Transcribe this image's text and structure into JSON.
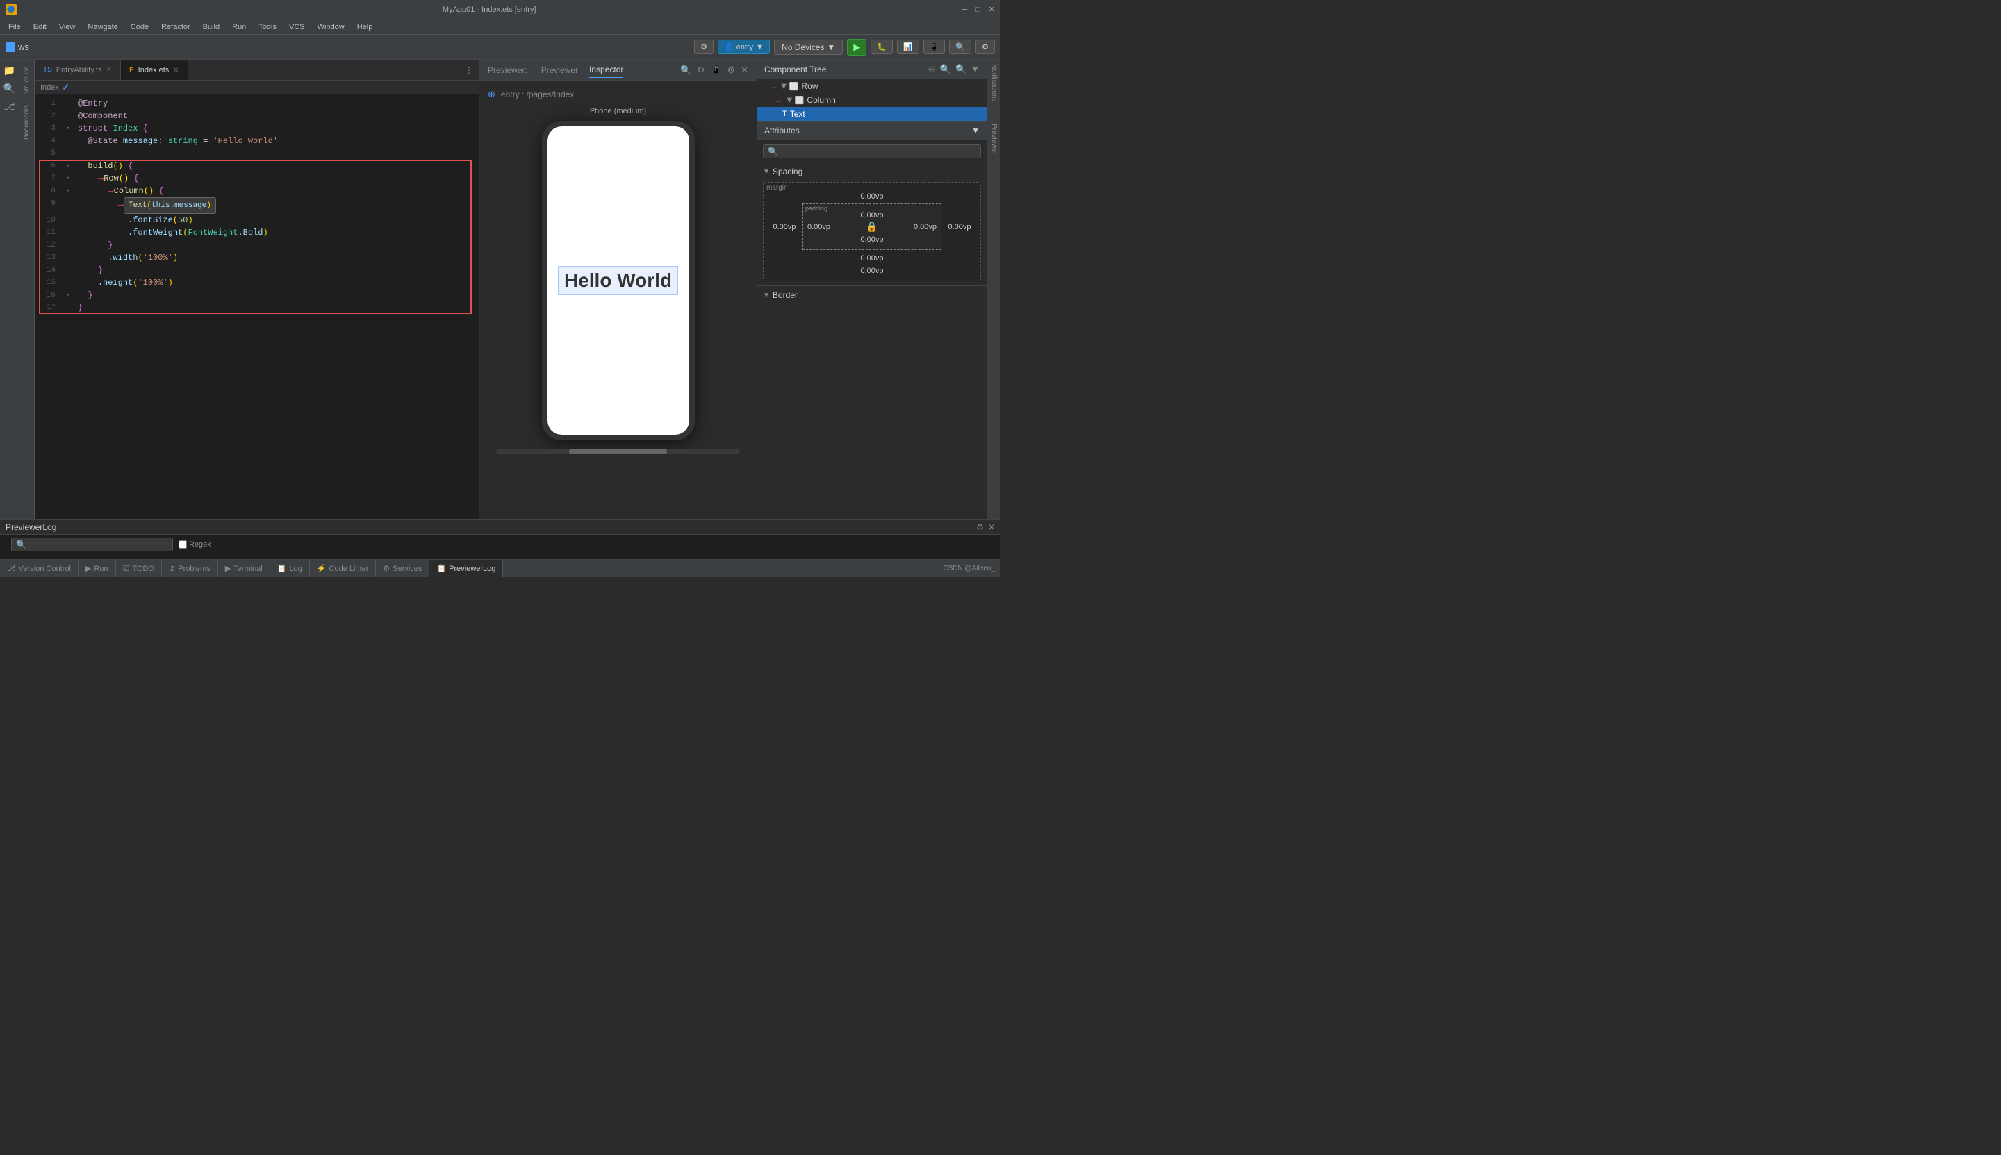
{
  "titlebar": {
    "app_name": "MyApp01 - Index.ets [entry]",
    "controls": [
      "minimize",
      "maximize",
      "close"
    ],
    "ws_label": "ws"
  },
  "menubar": {
    "items": [
      "File",
      "Edit",
      "View",
      "Navigate",
      "Code",
      "Refactor",
      "Build",
      "Run",
      "Tools",
      "VCS",
      "Window",
      "Help"
    ]
  },
  "toolbar": {
    "ws_label": "ws",
    "entry_label": "entry",
    "no_devices_label": "No Devices",
    "run_tooltip": "Run",
    "debug_tooltip": "Debug"
  },
  "tabs": {
    "active": "Index.ets",
    "items": [
      {
        "label": "EntryAbility.ts",
        "icon": "ts",
        "active": false
      },
      {
        "label": "Index.ets",
        "icon": "ets",
        "active": true
      }
    ]
  },
  "editor": {
    "filename": "Index.ets",
    "check_mark": "✓",
    "lines": [
      {
        "num": 1,
        "content": "@Entry",
        "type": "decorator"
      },
      {
        "num": 2,
        "content": "@Component",
        "type": "decorator"
      },
      {
        "num": 3,
        "content": "struct Index {",
        "type": "struct"
      },
      {
        "num": 4,
        "content": "  @State message: string = 'Hello World'",
        "type": "state"
      },
      {
        "num": 5,
        "content": "",
        "type": "empty"
      },
      {
        "num": 6,
        "content": "  build() {",
        "type": "fn"
      },
      {
        "num": 7,
        "content": "    Row() {",
        "type": "row"
      },
      {
        "num": 8,
        "content": "      Column() {",
        "type": "column"
      },
      {
        "num": 9,
        "content": "        Text(this.message)",
        "type": "text_call"
      },
      {
        "num": 10,
        "content": "          .fontSize(50)",
        "type": "method"
      },
      {
        "num": 11,
        "content": "          .fontWeight(FontWeight.Bold)",
        "type": "method"
      },
      {
        "num": 12,
        "content": "      }",
        "type": "brace"
      },
      {
        "num": 13,
        "content": "      .width('100%')",
        "type": "method"
      },
      {
        "num": 14,
        "content": "    }",
        "type": "brace"
      },
      {
        "num": 15,
        "content": "    .height('100%')",
        "type": "method"
      },
      {
        "num": 16,
        "content": "  }",
        "type": "brace"
      },
      {
        "num": 17,
        "content": "}",
        "type": "brace"
      }
    ]
  },
  "breadcrumb": {
    "path": "Index"
  },
  "preview": {
    "tabs": [
      "Previewer",
      "Inspector"
    ],
    "active_tab": "Inspector",
    "path": "entry : /pages/Index",
    "phone_label": "Phone (medium)",
    "hello_world": "Hello World"
  },
  "component_tree": {
    "title": "Component Tree",
    "nodes": [
      {
        "label": "Row",
        "depth": 0,
        "expanded": true,
        "selected": false
      },
      {
        "label": "Column",
        "depth": 1,
        "expanded": true,
        "selected": false
      },
      {
        "label": "Text",
        "depth": 2,
        "expanded": false,
        "selected": true
      }
    ]
  },
  "attributes": {
    "title": "Attributes",
    "search_placeholder": "",
    "spacing": {
      "title": "Spacing",
      "margin_label": "margin",
      "margin_top": "0.00vp",
      "margin_left": "0.00vp",
      "margin_right": "0.00vp",
      "margin_bottom": "0.00vp",
      "padding_label": "padding",
      "padding_top": "0.00vp",
      "padding_left": "0.00vp",
      "padding_right": "0.00vp",
      "padding_bottom": "0.00vp",
      "center_value": "0.00vp"
    },
    "border": {
      "title": "Border"
    }
  },
  "bottom_tabs": {
    "items": [
      {
        "label": "Version Control",
        "icon": "git",
        "active": false
      },
      {
        "label": "Run",
        "icon": "run",
        "active": false
      },
      {
        "label": "TODO",
        "icon": "todo",
        "active": false
      },
      {
        "label": "Problems",
        "icon": "problems",
        "active": false
      },
      {
        "label": "Terminal",
        "icon": "terminal",
        "active": false
      },
      {
        "label": "Log",
        "icon": "log",
        "active": false
      },
      {
        "label": "Code Linter",
        "icon": "lint",
        "active": false
      },
      {
        "label": "Services",
        "icon": "services",
        "active": false
      },
      {
        "label": "PreviewerLog",
        "icon": "log",
        "active": true
      }
    ]
  },
  "log_panel": {
    "title": "PreviewerLog",
    "search_placeholder": "🔍",
    "regex_label": "Regex"
  },
  "status_bar": {
    "items": [
      "Version Control",
      "⚡ Run",
      "☑ TODO",
      "⊘ Problems",
      "> Terminal",
      "📋 Log",
      "⚡ Code Linter",
      "⚙ Services",
      "📋 PreviewerLog"
    ],
    "right_items": [
      "CSDN @Aileen_"
    ]
  },
  "left_panels": [
    "Structure",
    "Bookmarks"
  ],
  "right_panels": [
    "Notifications",
    "Previewer"
  ],
  "colors": {
    "accent": "#4a9eff",
    "background": "#2b2b2b",
    "panel": "#3c3f41",
    "editor_bg": "#1e1e1e",
    "selected_tree": "#2167af",
    "red": "#e05252",
    "green": "#4caf50",
    "status_bar": "#1a5f8a"
  }
}
